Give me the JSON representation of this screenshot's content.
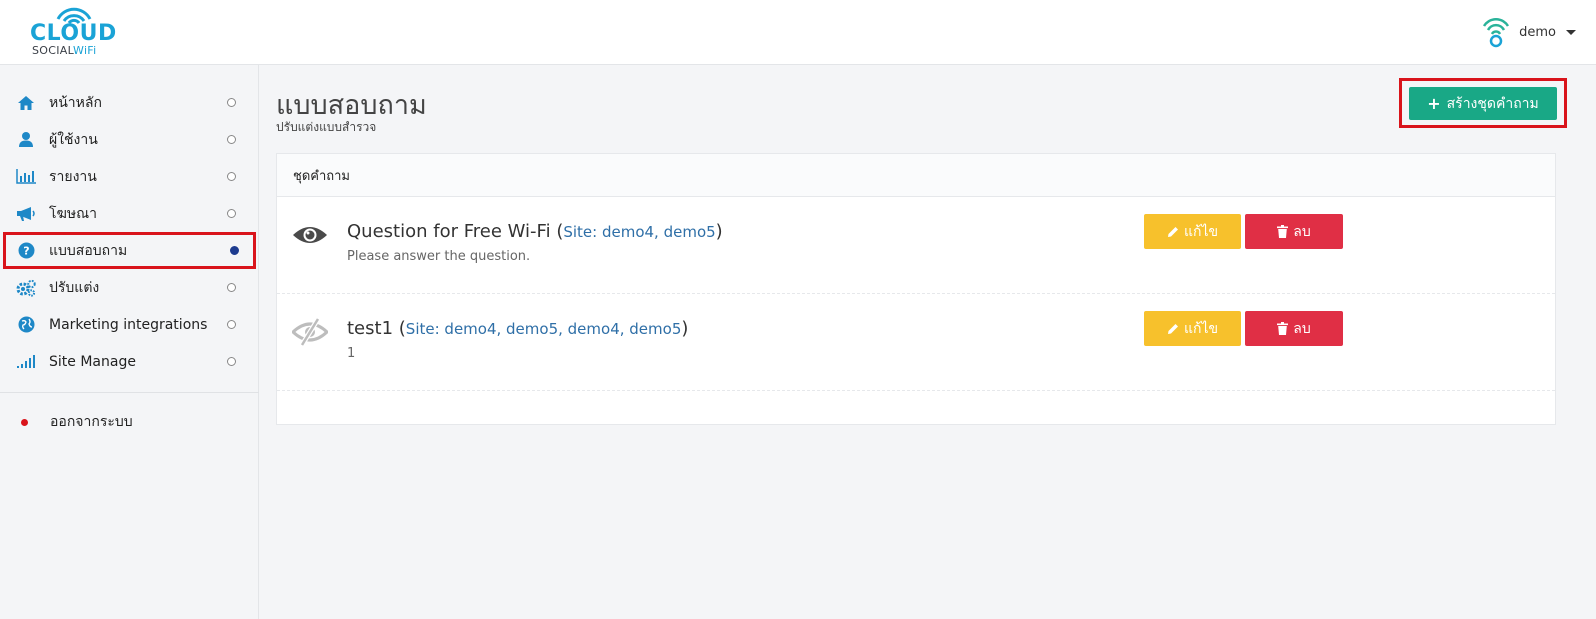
{
  "brand": {
    "logo_main": "CLOUD",
    "logo_sub_a": "SOCIAL",
    "logo_sub_b": "WiFi",
    "accent": "#1aa3d6"
  },
  "header": {
    "user_name": "demo"
  },
  "sidebar": {
    "items": [
      {
        "label": "หน้าหลัก",
        "icon": "home-icon"
      },
      {
        "label": "ผู้ใช้งาน",
        "icon": "user-icon"
      },
      {
        "label": "รายงาน",
        "icon": "bar-chart-icon"
      },
      {
        "label": "โฆษณา",
        "icon": "megaphone-icon"
      },
      {
        "label": "แบบสอบถาม",
        "icon": "question-circle-icon",
        "active": true
      },
      {
        "label": "ปรับแต่ง",
        "icon": "gears-icon"
      },
      {
        "label": "Marketing integrations",
        "icon": "globe-icon"
      },
      {
        "label": "Site Manage",
        "icon": "signal-icon"
      }
    ],
    "logout_label": "ออกจากระบบ"
  },
  "main": {
    "title": "แบบสอบถาม",
    "subtitle": "ปรับแต่งแบบสำรวจ",
    "create_button": "สร้างชุดคำถาม",
    "panel_title": "ชุดคำถาม",
    "questions": [
      {
        "title": "Question for Free Wi-Fi",
        "site_prefix": "(",
        "site_text": "Site: demo4, demo5",
        "site_suffix": ")",
        "description": "Please answer the question.",
        "visible": true,
        "edit_label": "แก้ไข",
        "delete_label": "ลบ"
      },
      {
        "title": "test1",
        "site_prefix": "(",
        "site_text": "Site: demo4, demo5, demo4, demo5",
        "site_suffix": ")",
        "description": "1",
        "visible": false,
        "edit_label": "แก้ไข",
        "delete_label": "ลบ"
      }
    ]
  },
  "colors": {
    "create": "#19a886",
    "edit": "#f7c12c",
    "delete": "#e02f45",
    "highlight": "#d9141b"
  }
}
